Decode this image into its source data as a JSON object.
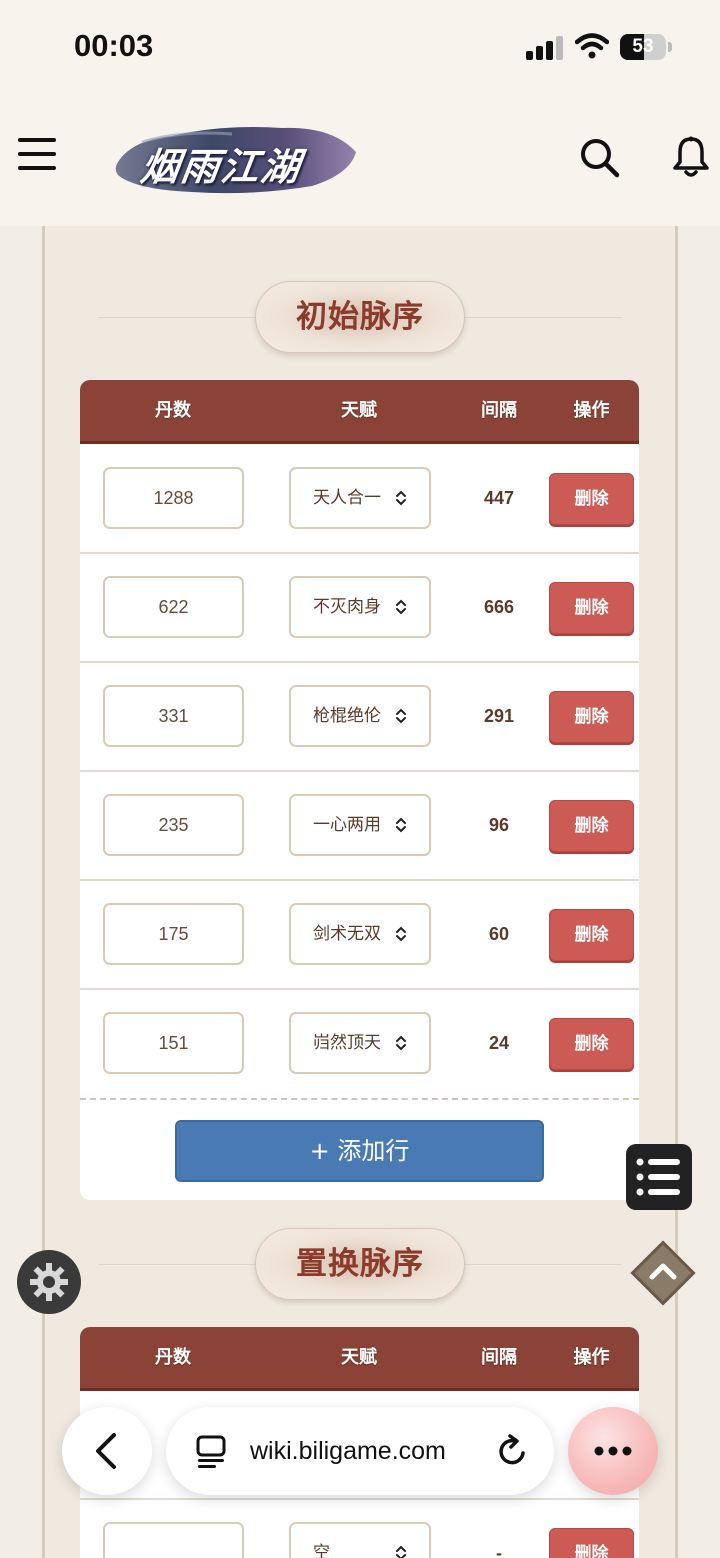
{
  "status_bar": {
    "time": "00:03",
    "battery": "53",
    "battery_level": 53
  },
  "site": {
    "logo_text": "烟雨江湖"
  },
  "sections": [
    {
      "title": "初始脉序",
      "headers": [
        "丹数",
        "天赋",
        "间隔",
        "操作"
      ],
      "rows": [
        {
          "qty": "1288",
          "talent": "天人合一",
          "interval": "447",
          "action": "删除"
        },
        {
          "qty": "622",
          "talent": "不灭肉身",
          "interval": "666",
          "action": "删除"
        },
        {
          "qty": "331",
          "talent": "枪棍绝伦",
          "interval": "291",
          "action": "删除"
        },
        {
          "qty": "235",
          "talent": "一心两用",
          "interval": "96",
          "action": "删除"
        },
        {
          "qty": "175",
          "talent": "剑术无双",
          "interval": "60",
          "action": "删除"
        },
        {
          "qty": "151",
          "talent": "岿然顶天",
          "interval": "24",
          "action": "删除"
        }
      ],
      "add_label": "+ 添加行"
    },
    {
      "title": "置换脉序",
      "headers": [
        "丹数",
        "天赋",
        "间隔",
        "操作"
      ],
      "rows": [
        {
          "qty": "",
          "talent": "空",
          "interval": "-",
          "action": "删除"
        }
      ]
    }
  ],
  "browser": {
    "url": "wiki.biligame.com"
  },
  "colors": {
    "table_header": "#8a4336",
    "delete_button": "#cc5a55",
    "add_button": "#4a7ab3",
    "section_title": "#8c3a2a"
  }
}
